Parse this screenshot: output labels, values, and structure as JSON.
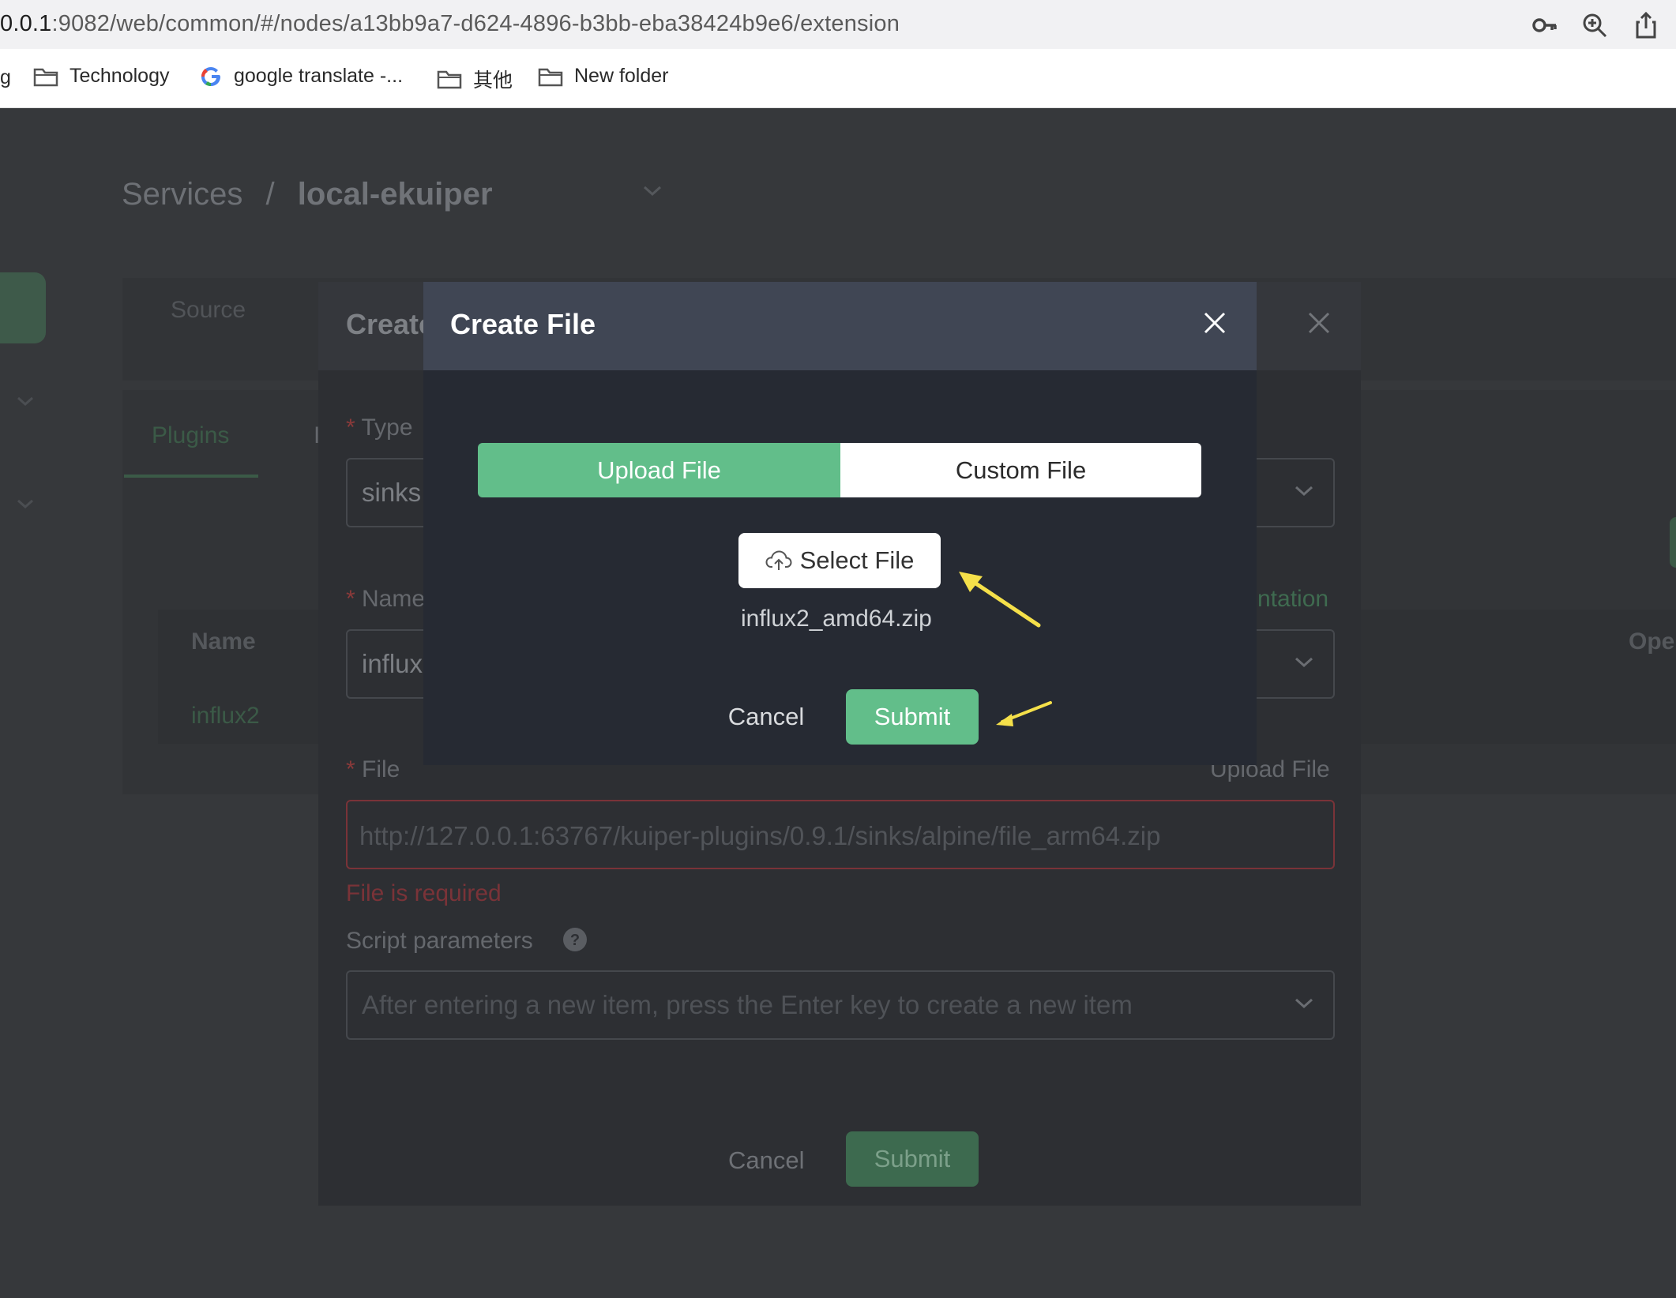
{
  "browser": {
    "url_host": "0.0.1",
    "url_rest": ":9082/web/common/#/nodes/a13bb9a7-d624-4896-b3bb-eba38424b9e6/extension",
    "bookmarks": [
      {
        "label": "g"
      },
      {
        "label": "Technology"
      },
      {
        "label": "google translate -..."
      },
      {
        "label": "其他"
      },
      {
        "label": "New folder"
      }
    ]
  },
  "page": {
    "breadcrumb_root": "Services",
    "breadcrumb_sep": "/",
    "breadcrumb_current": "local-ekuiper",
    "tab_source": "Source",
    "tab_plugins": "Plugins",
    "tab_partial": "I",
    "table_header_name": "Name",
    "table_header_ops": "Ope",
    "table_row_name": "influx2"
  },
  "create_plugin_modal": {
    "title": "Create",
    "type_label": "Type",
    "type_value": "sinks",
    "name_label": "Name",
    "name_value": "influx",
    "documentation_link": "ntation",
    "file_label": "File",
    "upload_file_link": "Upload File",
    "file_placeholder": "http://127.0.0.1:63767/kuiper-plugins/0.9.1/sinks/alpine/file_arm64.zip",
    "file_error": "File is required",
    "script_params_label": "Script parameters",
    "script_params_placeholder": "After entering a new item, press the Enter key to create a new item",
    "cancel": "Cancel",
    "submit": "Submit"
  },
  "create_file_modal": {
    "title": "Create File",
    "tab_upload": "Upload File",
    "tab_custom": "Custom File",
    "select_file": "Select File",
    "selected_file": "influx2_amd64.zip",
    "cancel": "Cancel",
    "submit": "Submit"
  },
  "colors": {
    "accent": "#62be8a",
    "modal_header": "#404654",
    "arrow": "#f5e04a"
  }
}
